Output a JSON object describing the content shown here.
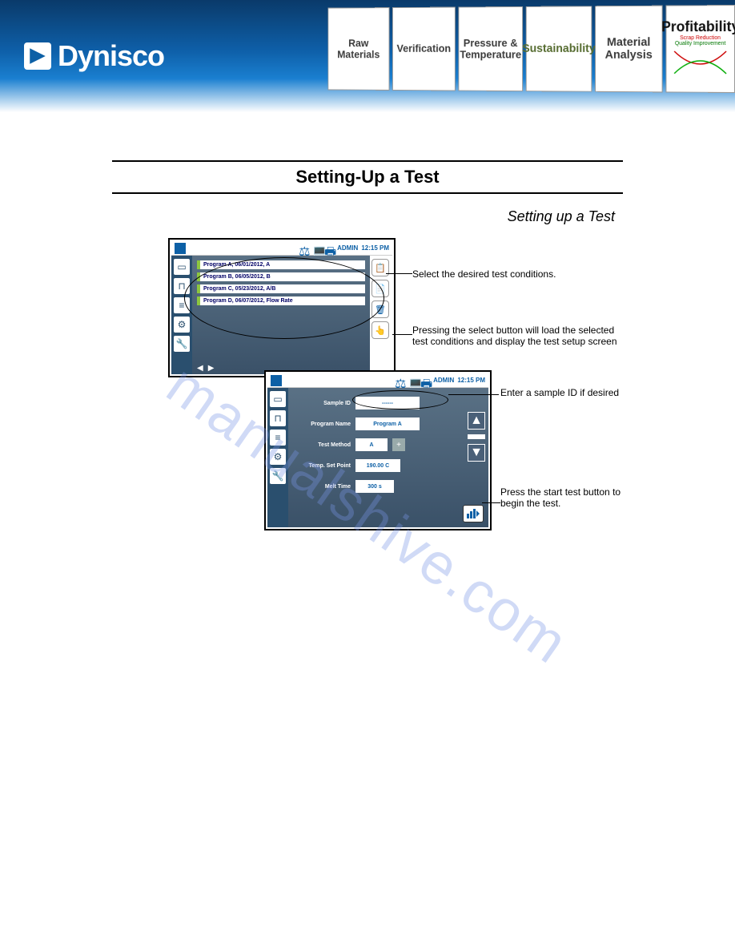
{
  "banner": {
    "brand": "Dynisco",
    "tiles": [
      {
        "title": "Raw Materials"
      },
      {
        "title": "Verification"
      },
      {
        "title": "Pressure & Temperature"
      },
      {
        "title": "Sustainability"
      },
      {
        "title": "Material Analysis"
      },
      {
        "title": "Profitability",
        "sub1": "Scrap Reduction",
        "sub2": "Quality Improvement"
      }
    ]
  },
  "page": {
    "title": "Setting-Up a Test",
    "subtitle": "Setting up a Test"
  },
  "device1": {
    "user": "ADMIN",
    "time": "12:15 PM",
    "programs": [
      "Program A, 06/01/2012, A",
      "Program B, 06/05/2012, B",
      "Program C, 05/23/2012, A/B",
      "Program D, 06/07/2012, Flow Rate"
    ]
  },
  "device2": {
    "user": "ADMIN",
    "time": "12:15 PM",
    "fields": {
      "sample_id_label": "Sample ID",
      "sample_id_value": "------",
      "program_name_label": "Program Name",
      "program_name_value": "Program A",
      "test_method_label": "Test Method",
      "test_method_value": "A",
      "temp_label": "Temp. Set Point",
      "temp_value": "190.00 C",
      "melt_label": "Melt Time",
      "melt_value": "300 s"
    }
  },
  "annotations": {
    "a1": "Select the desired test conditions.",
    "a2": "Pressing the select button will load the selected test conditions and display the test setup screen",
    "a3": "Enter a sample ID if desired",
    "a4": "Press the start test button to begin the test."
  },
  "watermark": "manualshive.com"
}
